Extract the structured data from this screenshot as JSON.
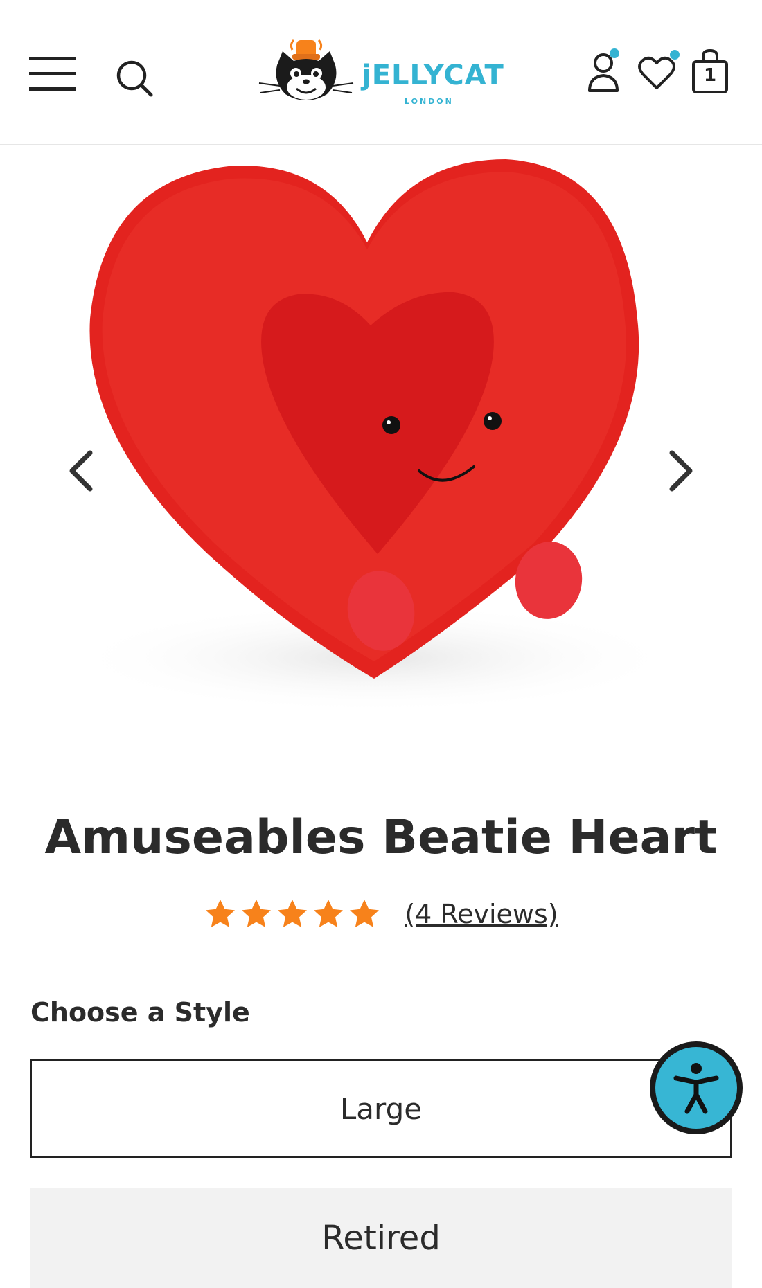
{
  "header": {
    "logo_text": "jELLYCAT",
    "logo_sub": "LONDON",
    "bag_count": "1"
  },
  "product": {
    "title": "Amuseables Beatie Heart",
    "rating_stars": 5,
    "reviews_label": "(4 Reviews)"
  },
  "style_selector": {
    "label": "Choose a Style",
    "options": [
      "Large",
      "Retired"
    ]
  },
  "colors": {
    "accent": "#34b3d2",
    "star": "#f7821b",
    "heart": "#e01f1f"
  }
}
